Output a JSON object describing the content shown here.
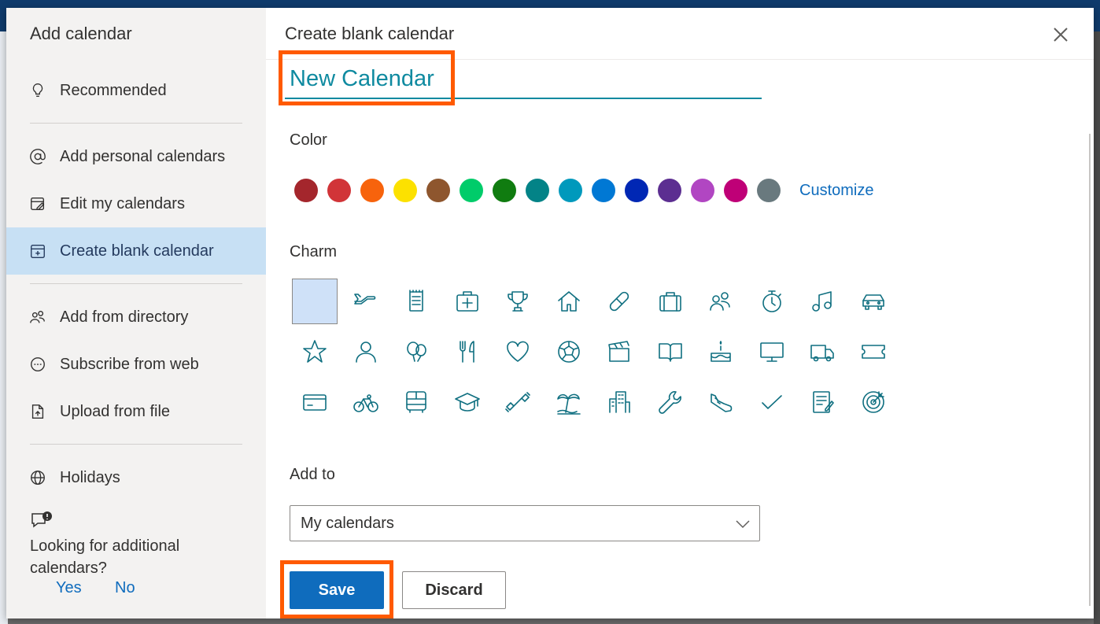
{
  "sidebar": {
    "title": "Add calendar",
    "items": [
      {
        "label": "Recommended",
        "icon": "lightbulb-icon"
      },
      {
        "label": "Add personal calendars",
        "icon": "at-sign-icon"
      },
      {
        "label": "Edit my calendars",
        "icon": "edit-calendar-icon"
      },
      {
        "label": "Create blank calendar",
        "icon": "calendar-add-icon",
        "selected": true
      },
      {
        "label": "Add from directory",
        "icon": "people-icon"
      },
      {
        "label": "Subscribe from web",
        "icon": "link-icon"
      },
      {
        "label": "Upload from file",
        "icon": "file-upload-icon"
      },
      {
        "label": "Holidays",
        "icon": "globe-icon"
      }
    ],
    "feedback": {
      "icon": "feedback-icon",
      "question": "Looking for additional calendars?",
      "yes": "Yes",
      "no": "No"
    }
  },
  "main": {
    "title": "Create blank calendar",
    "name_value": "New Calendar",
    "color_label": "Color",
    "colors": [
      "#a4262c",
      "#d13438",
      "#f7630c",
      "#fce100",
      "#8e562e",
      "#00cc6a",
      "#107c10",
      "#038387",
      "#0099bc",
      "#0078d4",
      "#0027b4",
      "#5c2e91",
      "#b146c2",
      "#bf0077",
      "#69797e"
    ],
    "customize_label": "Customize",
    "charm_label": "Charm",
    "charms": [
      "none",
      "airplane-icon",
      "notepad-icon",
      "first-aid-icon",
      "trophy-icon",
      "home-icon",
      "bandage-icon",
      "briefcase-icon",
      "people-icon",
      "stopwatch-icon",
      "music-note-icon",
      "car-icon",
      "star-icon",
      "person-icon",
      "balloon-icon",
      "fork-knife-icon",
      "heart-icon",
      "soccer-ball-icon",
      "clapperboard-icon",
      "book-icon",
      "cake-icon",
      "monitor-icon",
      "truck-icon",
      "ticket-icon",
      "credit-card-icon",
      "bicycle-icon",
      "bus-icon",
      "graduation-cap-icon",
      "dumbbell-icon",
      "beach-icon",
      "building-icon",
      "wrench-icon",
      "shoe-icon",
      "checkmark-icon",
      "clipboard-icon",
      "target-icon"
    ],
    "add_to_label": "Add to",
    "add_to_value": "My calendars",
    "save_label": "Save",
    "discard_label": "Discard"
  },
  "accent_color": "#0f6cbd",
  "highlight_color": "#ff5a00"
}
